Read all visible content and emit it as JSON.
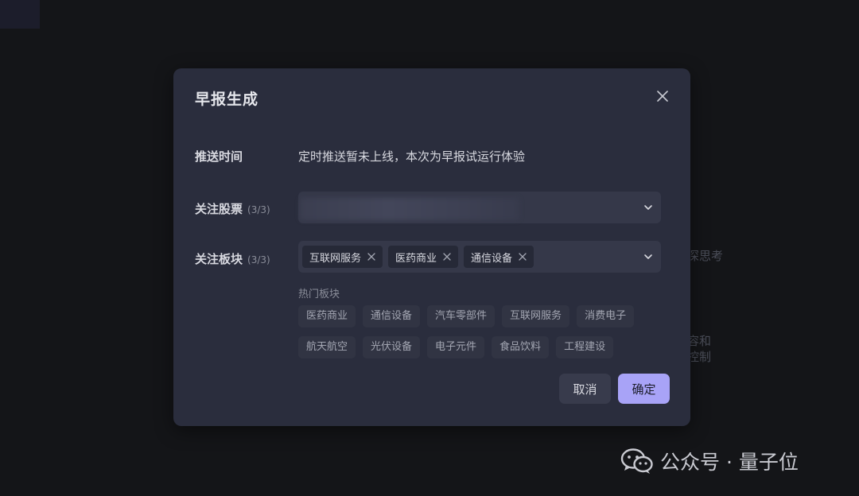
{
  "background": {
    "fragment_1": "深思考",
    "fragment_2": "容和",
    "fragment_3": "控制"
  },
  "modal": {
    "title": "早报生成",
    "close_icon": "close-icon",
    "push_time": {
      "label": "推送时间",
      "note": "定时推送暂未上线，本次为早报试运行体验"
    },
    "stocks": {
      "label": "关注股票",
      "count": "(3/3)"
    },
    "sectors": {
      "label": "关注板块",
      "count": "(3/3)",
      "selected": [
        "互联网服务",
        "医药商业",
        "通信设备"
      ]
    },
    "hot_sectors": {
      "title": "热门板块",
      "row1": [
        "医药商业",
        "通信设备",
        "汽车零部件",
        "互联网服务",
        "消费电子"
      ],
      "row2": [
        "航天航空",
        "光伏设备",
        "电子元件",
        "食品饮料",
        "工程建设"
      ]
    },
    "buttons": {
      "cancel": "取消",
      "confirm": "确定"
    }
  },
  "watermark": {
    "text": "公众号 · 量子位",
    "icon": "wechat-icon"
  },
  "colors": {
    "accent": "#a8a3f7",
    "modal_bg": "#2a2d3d",
    "page_bg": "#141518"
  }
}
